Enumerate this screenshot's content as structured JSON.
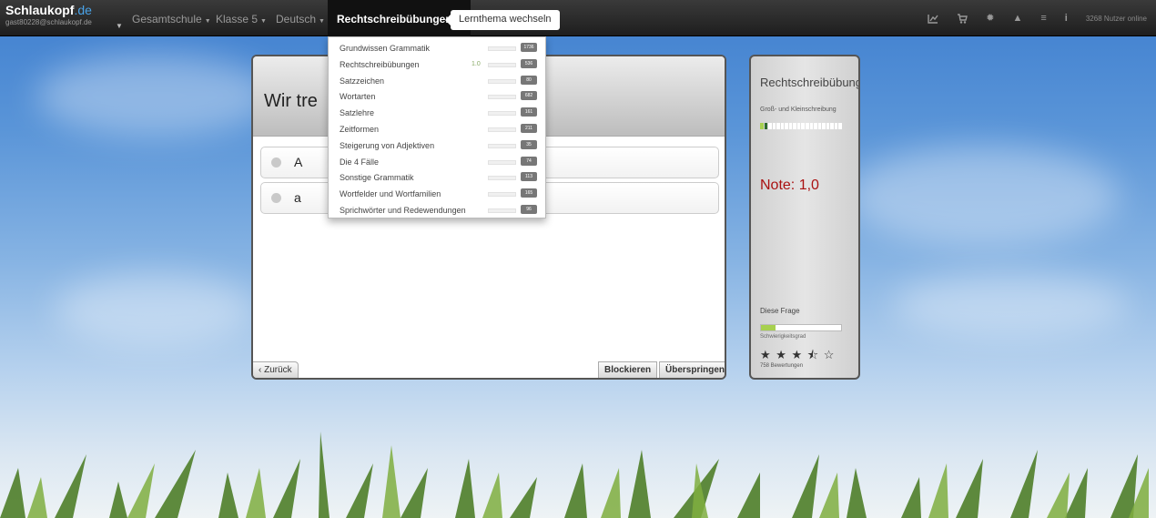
{
  "brand": {
    "name": "Schlaukopf",
    "tld": ".de",
    "user_email": "gast80228@schlaukopf.de"
  },
  "nav": {
    "items": [
      {
        "label": "Gesamtschule"
      },
      {
        "label": "Klasse 5"
      },
      {
        "label": "Deutsch"
      }
    ],
    "active": {
      "label": "Rechtschreibübungen"
    },
    "tooltip": "Lernthema wechseln",
    "icons": [
      "chart-icon",
      "cart-icon",
      "gear-icon",
      "warning-icon",
      "menu-icon",
      "info-icon"
    ],
    "online_count": "3268 Nutzer online"
  },
  "dropdown": {
    "items": [
      {
        "label": "Grundwissen Grammatik",
        "grade": "",
        "count": "1736"
      },
      {
        "label": "Rechtschreibübungen",
        "grade": "1.0",
        "count": "536"
      },
      {
        "label": "Satzzeichen",
        "grade": "",
        "count": "80"
      },
      {
        "label": "Wortarten",
        "grade": "",
        "count": "682"
      },
      {
        "label": "Satzlehre",
        "grade": "",
        "count": "161"
      },
      {
        "label": "Zeitformen",
        "grade": "",
        "count": "211"
      },
      {
        "label": "Steigerung von Adjektiven",
        "grade": "",
        "count": "35"
      },
      {
        "label": "Die 4 Fälle",
        "grade": "",
        "count": "74"
      },
      {
        "label": "Sonstige Grammatik",
        "grade": "",
        "count": "113"
      },
      {
        "label": "Wortfelder und Wortfamilien",
        "grade": "",
        "count": "165"
      },
      {
        "label": "Sprichwörter und Redewendungen",
        "grade": "",
        "count": "96"
      }
    ]
  },
  "question": {
    "text": "Wir tre",
    "answers": [
      {
        "label": "A"
      },
      {
        "label": "a"
      }
    ],
    "back_label": "‹ Zurück",
    "block_label": "Blockieren",
    "skip_label": "Überspringen"
  },
  "sidebar": {
    "topic": "Rechtschreibübungen",
    "subtopic": "Groß- und Kleinschreibung",
    "progress_colors": [
      "#a7d04f",
      "#2e6b2e"
    ],
    "grade": "Note: 1,0",
    "this_question": "Diese Frage",
    "difficulty": 0.18,
    "difficulty_label": "Schwierigkeitsgrad",
    "stars": "★ ★ ★ ⯪ ☆",
    "rating_value": 3.5,
    "ratings": "758 Bewertungen"
  }
}
